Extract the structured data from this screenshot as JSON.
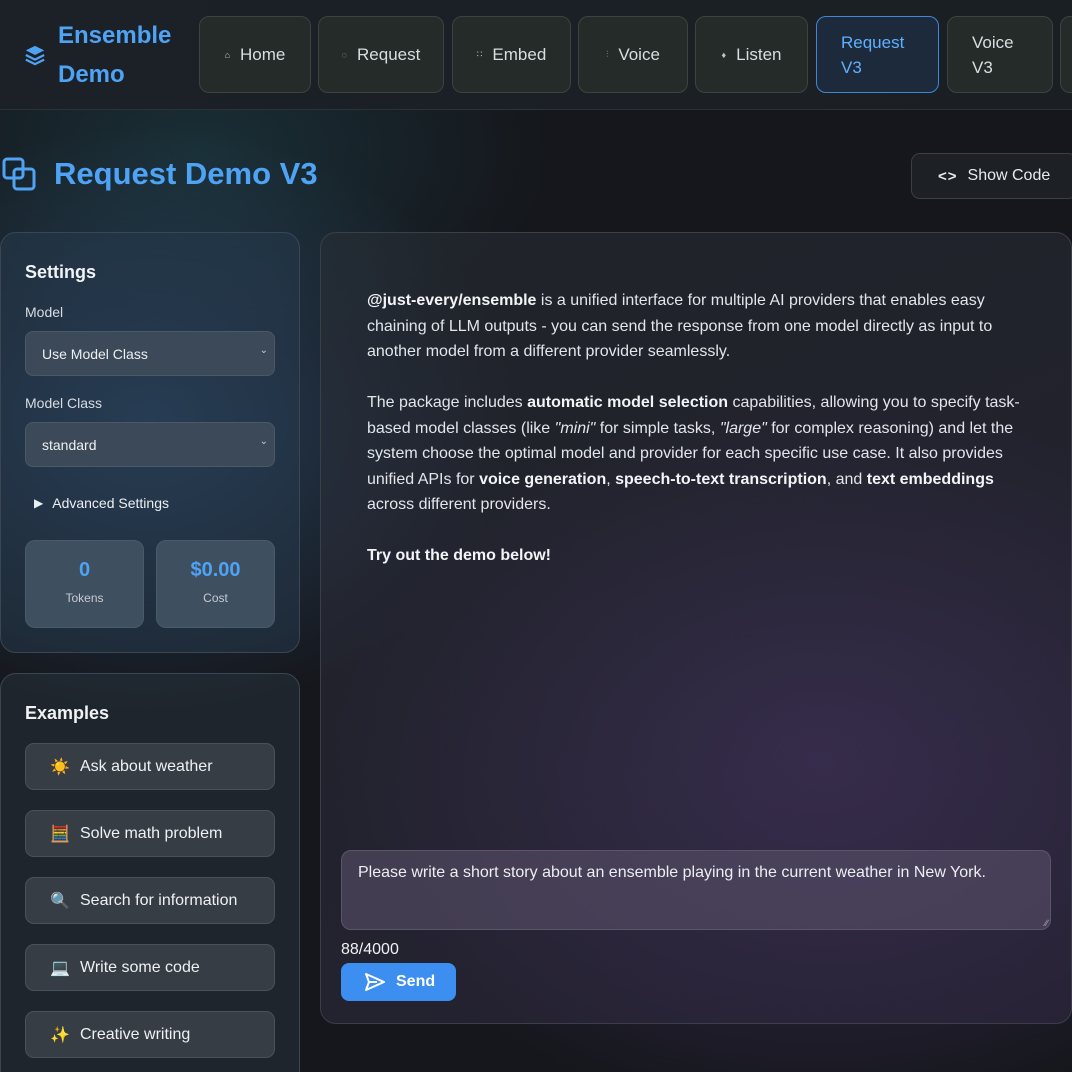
{
  "brand": {
    "line1": "Ensemble",
    "line2": "Demo",
    "icon": "layers-icon"
  },
  "nav": {
    "tabs": [
      {
        "id": "home",
        "label": "Home",
        "icon": "house-icon",
        "glyph": "⌂"
      },
      {
        "id": "request",
        "label": "Request",
        "icon": "chat-icon",
        "glyph": "◌"
      },
      {
        "id": "embed",
        "label": "Embed",
        "icon": "grid-icon",
        "glyph": "∷"
      },
      {
        "id": "voice",
        "label": "Voice",
        "icon": "waveform-icon",
        "glyph": "⫶"
      },
      {
        "id": "listen",
        "label": "Listen",
        "icon": "microphone-icon",
        "glyph": "♦"
      },
      {
        "id": "request-v3",
        "line1": "Request",
        "line2": "V3",
        "active": true
      },
      {
        "id": "voice-v3",
        "line1": "Voice",
        "line2": "V3"
      }
    ]
  },
  "page": {
    "title": "Request Demo V3",
    "title_icon": "copy-squares-icon"
  },
  "show_code": {
    "label": "Show Code",
    "icon": "code-brackets-icon",
    "glyph": "<>"
  },
  "settings": {
    "heading": "Settings",
    "model": {
      "label": "Model",
      "value": "Use Model Class"
    },
    "model_class": {
      "label": "Model Class",
      "value": "standard"
    },
    "advanced_label": "Advanced Settings",
    "tokens": {
      "value": "0",
      "label": "Tokens"
    },
    "cost": {
      "value": "$0.00",
      "label": "Cost"
    }
  },
  "examples": {
    "heading": "Examples",
    "items": [
      {
        "label": "Ask about weather",
        "icon": "sun-icon",
        "glyph": "☀️"
      },
      {
        "label": "Solve math problem",
        "icon": "abacus-icon",
        "glyph": "🧮"
      },
      {
        "label": "Search for information",
        "icon": "magnifier-icon",
        "glyph": "🔍"
      },
      {
        "label": "Write some code",
        "icon": "laptop-icon",
        "glyph": "💻"
      },
      {
        "label": "Creative writing",
        "icon": "sparkles-icon",
        "glyph": "✨"
      }
    ]
  },
  "intro": {
    "p1_pkg": "@just-every/ensemble",
    "p1_rest": " is a unified interface for multiple AI providers that enables easy chaining of LLM outputs - you can send the response from one model directly as input to another model from a different provider seamlessly.",
    "p2_a": "The package includes ",
    "p2_b": "automatic model selection",
    "p2_c": " capabilities, allowing you to specify task-based model classes (like ",
    "p2_d": "\"mini\"",
    "p2_e": " for simple tasks, ",
    "p2_f": "\"large\"",
    "p2_g": " for complex reasoning) and let the system choose the optimal model and provider for each specific use case. It also provides unified APIs for ",
    "p2_h": "voice generation",
    "p2_i": ", ",
    "p2_j": "speech-to-text transcription",
    "p2_k": ", and ",
    "p2_l": "text embeddings",
    "p2_m": " across different providers.",
    "p3": "Try out the demo below!"
  },
  "composer": {
    "prompt": "Please write a short story about an ensemble playing in the current weather in New York.",
    "char_count": "88/4000",
    "send_label": "Send",
    "send_icon": "paper-plane-icon"
  },
  "colors": {
    "accent": "#4ea3f5",
    "send": "#3c8ef0"
  }
}
